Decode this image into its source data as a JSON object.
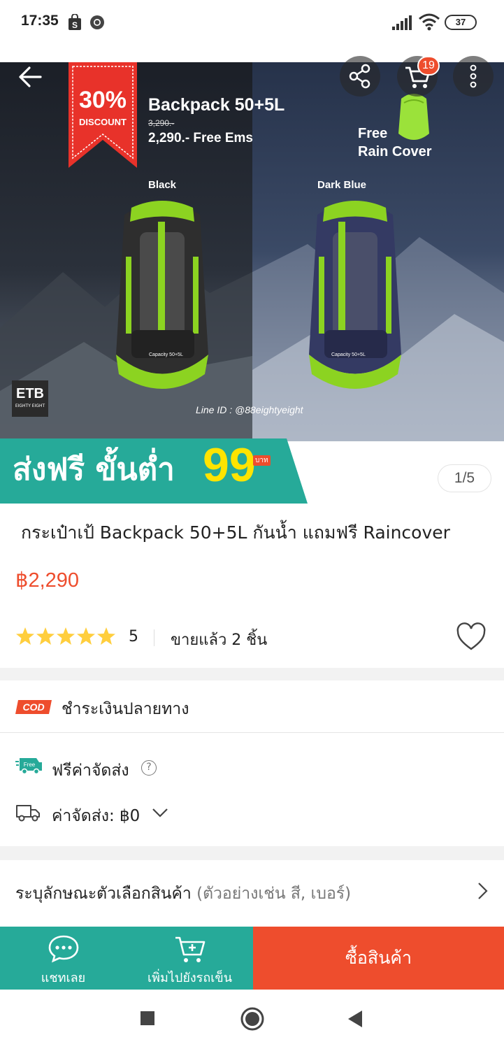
{
  "status_bar": {
    "time": "17:35",
    "battery": "37"
  },
  "hero": {
    "discount_percent": "30%",
    "discount_label": "DISCOUNT",
    "product_title": "Backpack 50+5L",
    "old_price": "3,290.-",
    "new_price": "2,290.- Free Ems",
    "free_line1": "Free",
    "free_line2": "Rain Cover",
    "variant_left": "Black",
    "variant_right": "Dark Blue",
    "capacity_label": "Capacity 50+5L",
    "line_id": "Line ID : @88eightyeight",
    "brand_logo": "ETB",
    "brand_sub": "EIGHTY EIGHT"
  },
  "top_actions": {
    "cart_count": "19"
  },
  "promo": {
    "text": "ส่งฟรี ขั้นต่ำ",
    "amount": "99",
    "unit": "บาท"
  },
  "image_counter": "1/5",
  "product": {
    "title": "กระเป๋าเป้ Backpack 50+5L กันน้ำ แถมฟรี Raincover",
    "price": "฿2,290",
    "rating": "5",
    "sold": "ขายแล้ว 2 ชิ้น"
  },
  "cod": {
    "badge": "COD",
    "label": "ชำระเงินปลายทาง"
  },
  "shipping": {
    "free_badge": "Free",
    "free_label": "ฟรีค่าจัดส่ง",
    "help": "?",
    "fee_label": "ค่าจัดส่ง: ฿0"
  },
  "variant": {
    "label": "ระบุลักษณะตัวเลือกสินค้า",
    "hint": "(ตัวอย่างเช่น สี, เบอร์)"
  },
  "action_bar": {
    "chat_label": "แชทเลย",
    "add_cart_label": "เพิ่มไปยังรถเข็น",
    "buy_label": "ซื้อสินค้า"
  },
  "colors": {
    "accent": "#ee4d2d",
    "teal": "#26aa99",
    "promo_yellow": "#ffe400",
    "star": "#ffce3d"
  }
}
